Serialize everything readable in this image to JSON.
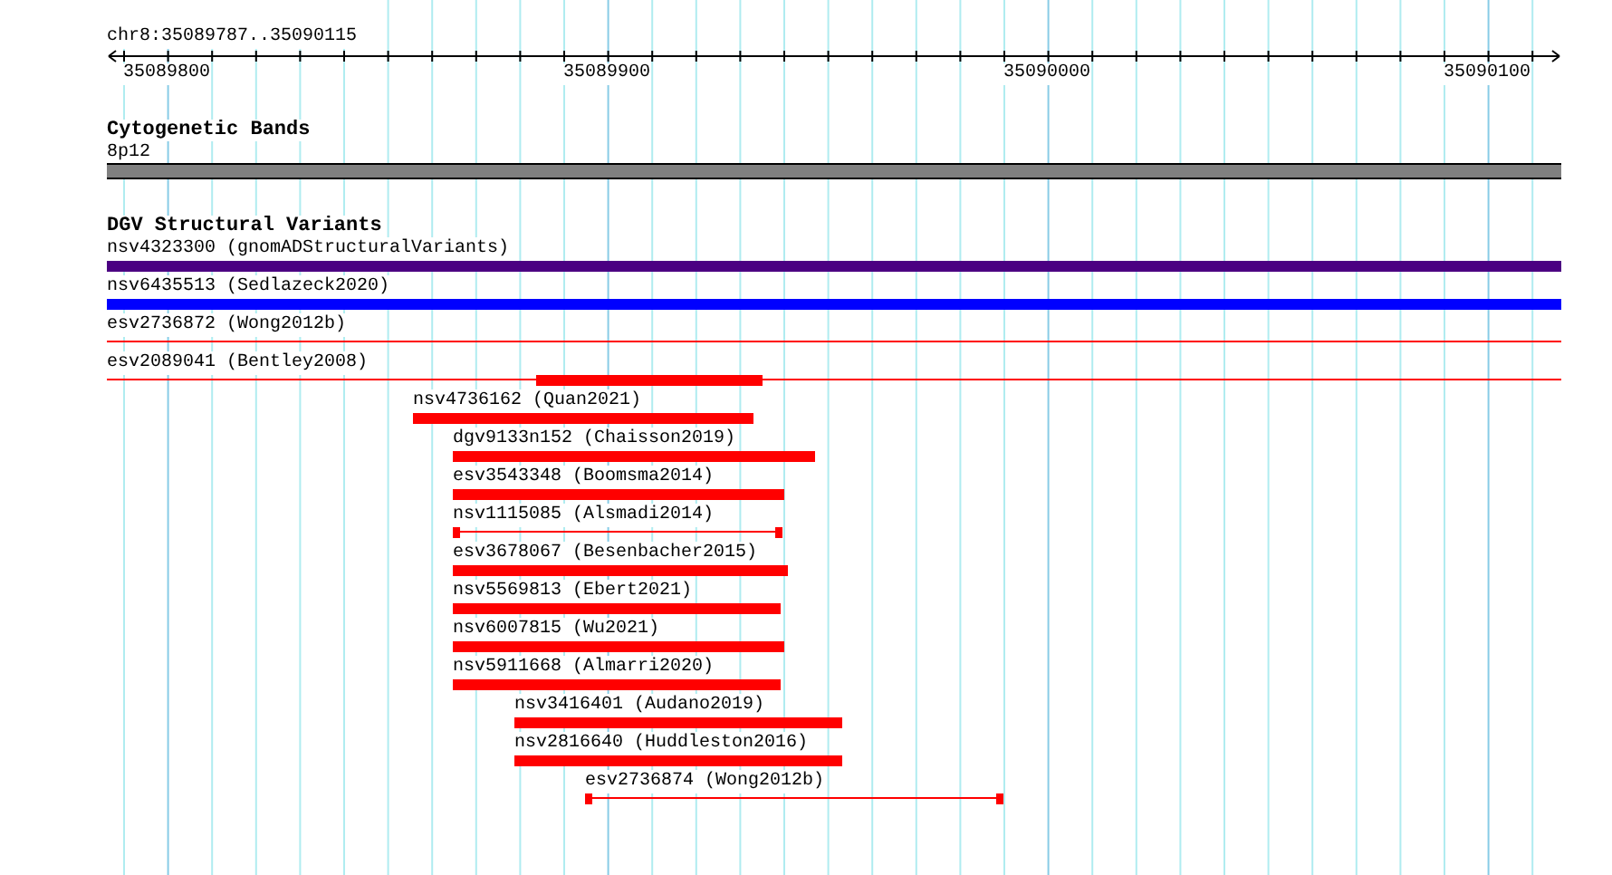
{
  "ruler": {
    "location": "chr8:35089787..35090115",
    "tick_labels": [
      "35089800",
      "35089900",
      "35090000",
      "35090100"
    ]
  },
  "tracks": [
    {
      "kind": "bands",
      "title": "Cytogenetic Bands",
      "features": [
        {
          "label": "8p12",
          "kind": "band",
          "color": "#808080"
        }
      ]
    },
    {
      "kind": "variants",
      "title": "DGV Structural Variants",
      "features": [
        {
          "label": "nsv4323300 (gnomADStructuralVariants)",
          "kind": "bar",
          "color": "#4b0082"
        },
        {
          "label": "nsv6435513 (Sedlazeck2020)",
          "kind": "bar",
          "color": "#0000ff"
        },
        {
          "label": "esv2736872 (Wong2012b)",
          "kind": "line",
          "color": "#ff0000"
        },
        {
          "label": "esv2089041 (Bentley2008)",
          "kind": "line-block",
          "color": "#ff0000"
        },
        {
          "label": "nsv4736162 (Quan2021)",
          "kind": "bar",
          "color": "#ff0000"
        },
        {
          "label": "dgv9133n152 (Chaisson2019)",
          "kind": "bar",
          "color": "#ff0000"
        },
        {
          "label": "esv3543348 (Boomsma2014)",
          "kind": "bar",
          "color": "#ff0000"
        },
        {
          "label": "nsv1115085 (Alsmadi2014)",
          "kind": "capped-line",
          "color": "#ff0000"
        },
        {
          "label": "esv3678067 (Besenbacher2015)",
          "kind": "bar",
          "color": "#ff0000"
        },
        {
          "label": "nsv5569813 (Ebert2021)",
          "kind": "bar",
          "color": "#ff0000"
        },
        {
          "label": "nsv6007815 (Wu2021)",
          "kind": "bar",
          "color": "#ff0000"
        },
        {
          "label": "nsv5911668 (Almarri2020)",
          "kind": "bar",
          "color": "#ff0000"
        },
        {
          "label": "nsv3416401 (Audano2019)",
          "kind": "bar",
          "color": "#ff0000"
        },
        {
          "label": "nsv2816640 (Huddleston2016)",
          "kind": "bar",
          "color": "#ff0000"
        },
        {
          "label": "esv2736874 (Wong2012b)",
          "kind": "capped-line",
          "color": "#ff0000"
        }
      ]
    }
  ]
}
